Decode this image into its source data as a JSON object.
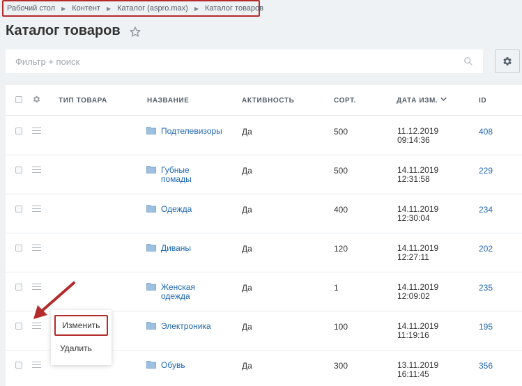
{
  "breadcrumb": {
    "items": [
      "Рабочий стол",
      "Контент",
      "Каталог (aspro.max)",
      "Каталог товаров"
    ],
    "separator": "▶"
  },
  "page": {
    "title": "Каталог товаров",
    "favorite_icon": "star-outline-icon"
  },
  "filter": {
    "placeholder": "Фильтр + поиск",
    "value": "",
    "search_icon": "search-icon",
    "settings_icon": "gear-icon"
  },
  "grid": {
    "columns": {
      "type": "ТИП ТОВАРА",
      "name": "НАЗВАНИЕ",
      "active": "АКТИВНОСТЬ",
      "sort": "СОРТ.",
      "date": "ДАТА ИЗМ.",
      "id": "ID"
    },
    "sort_indicator": "chevron-down-icon",
    "rows": [
      {
        "type": "",
        "name": "Подтелевизоры",
        "active": "Да",
        "sort": "500",
        "date": "11.12.2019",
        "time": "09:14:36",
        "id": "408"
      },
      {
        "type": "",
        "name": "Губные помады",
        "active": "Да",
        "sort": "500",
        "date": "14.11.2019",
        "time": "12:31:58",
        "id": "229"
      },
      {
        "type": "",
        "name": "Одежда",
        "active": "Да",
        "sort": "400",
        "date": "14.11.2019",
        "time": "12:30:04",
        "id": "234"
      },
      {
        "type": "",
        "name": "Диваны",
        "active": "Да",
        "sort": "120",
        "date": "14.11.2019",
        "time": "12:27:11",
        "id": "202"
      },
      {
        "type": "",
        "name": "Женская одежда",
        "active": "Да",
        "sort": "1",
        "date": "14.11.2019",
        "time": "12:09:02",
        "id": "235"
      },
      {
        "type": "",
        "name": "Электроника",
        "active": "Да",
        "sort": "100",
        "date": "14.11.2019",
        "time": "11:19:16",
        "id": "195"
      },
      {
        "type": "",
        "name": "Обувь",
        "active": "Да",
        "sort": "300",
        "date": "13.11.2019",
        "time": "16:11:45",
        "id": "356"
      }
    ]
  },
  "context_menu": {
    "edit_label": "Изменить",
    "delete_label": "Удалить"
  },
  "colors": {
    "accent": "#2067b0",
    "highlight": "#b32b2b",
    "background": "#eef2f4"
  }
}
